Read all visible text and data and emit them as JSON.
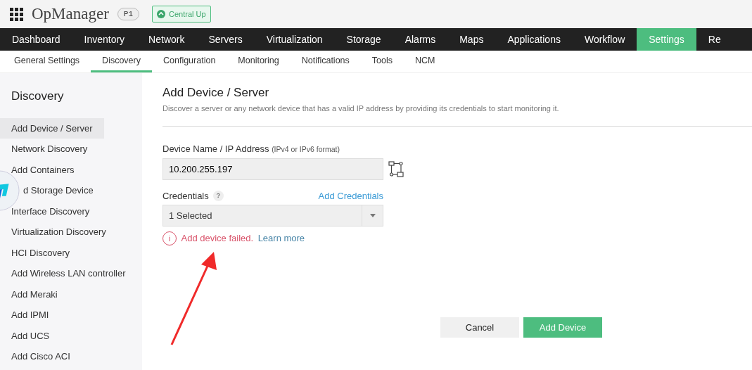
{
  "header": {
    "app_name": "OpManager",
    "badge": "P1",
    "status": "Central Up"
  },
  "main_nav": [
    {
      "label": "Dashboard",
      "selected": false
    },
    {
      "label": "Inventory",
      "selected": false
    },
    {
      "label": "Network",
      "selected": false
    },
    {
      "label": "Servers",
      "selected": false
    },
    {
      "label": "Virtualization",
      "selected": false
    },
    {
      "label": "Storage",
      "selected": false
    },
    {
      "label": "Alarms",
      "selected": false
    },
    {
      "label": "Maps",
      "selected": false
    },
    {
      "label": "Applications",
      "selected": false
    },
    {
      "label": "Workflow",
      "selected": false
    },
    {
      "label": "Settings",
      "selected": true
    },
    {
      "label": "Re",
      "selected": false
    }
  ],
  "sub_nav": [
    {
      "label": "General Settings",
      "selected": false
    },
    {
      "label": "Discovery",
      "selected": true
    },
    {
      "label": "Configuration",
      "selected": false
    },
    {
      "label": "Monitoring",
      "selected": false
    },
    {
      "label": "Notifications",
      "selected": false
    },
    {
      "label": "Tools",
      "selected": false
    },
    {
      "label": "NCM",
      "selected": false
    }
  ],
  "sidebar": {
    "title": "Discovery",
    "items": [
      {
        "label": "Add Device / Server",
        "selected": true
      },
      {
        "label": "Network Discovery",
        "selected": false
      },
      {
        "label": "Add Containers",
        "selected": false
      },
      {
        "label": "d Storage Device",
        "selected": false,
        "covered": true
      },
      {
        "label": "Interface Discovery",
        "selected": false
      },
      {
        "label": "Virtualization Discovery",
        "selected": false
      },
      {
        "label": "HCI Discovery",
        "selected": false
      },
      {
        "label": "Add Wireless LAN controller",
        "selected": false
      },
      {
        "label": "Add Meraki",
        "selected": false
      },
      {
        "label": "Add IPMI",
        "selected": false
      },
      {
        "label": "Add UCS",
        "selected": false
      },
      {
        "label": "Add Cisco ACI",
        "selected": false
      }
    ]
  },
  "form": {
    "title": "Add Device / Server",
    "description": "Discover a server or any network device that has a valid IP address by providing its credentials to start monitoring it.",
    "device_label": "Device Name / IP Address",
    "device_hint": "(IPv4 or IPv6 format)",
    "device_value": "10.200.255.197",
    "credentials_label": "Credentials",
    "help": "?",
    "add_credentials": "Add Credentials",
    "credentials_value": "1 Selected",
    "error_icon": "i",
    "error": "Add device failed.",
    "learn_more": "Learn more"
  },
  "buttons": {
    "cancel": "Cancel",
    "submit": "Add Device"
  }
}
